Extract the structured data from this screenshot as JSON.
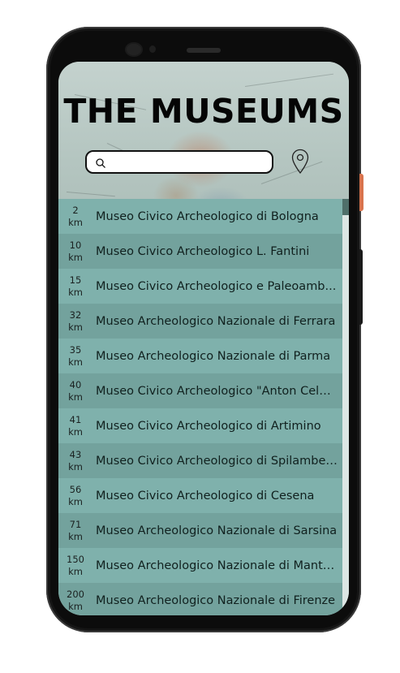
{
  "app": {
    "title": "THE MUSEUMS"
  },
  "search": {
    "value": "",
    "placeholder": ""
  },
  "icons": {
    "search": "search-icon",
    "location": "map-pin-icon"
  },
  "colors": {
    "row_light": "#7fb1ac",
    "row_dark": "#73a29d",
    "title": "#050505"
  },
  "museums": [
    {
      "distance": "2",
      "unit": "km",
      "name": "Museo Civico Archeologico di Bologna"
    },
    {
      "distance": "10",
      "unit": "km",
      "name": "Museo Civico Archeologico L. Fantini"
    },
    {
      "distance": "15",
      "unit": "km",
      "name": "Museo Civico Archeologico e Paleoamb..."
    },
    {
      "distance": "32",
      "unit": "km",
      "name": "Museo Archeologico Nazionale di Ferrara"
    },
    {
      "distance": "35",
      "unit": "km",
      "name": "Museo Archeologico Nazionale di Parma"
    },
    {
      "distance": "40",
      "unit": "km",
      "name": "Museo Civico Archeologico \"Anton Celest..."
    },
    {
      "distance": "41",
      "unit": "km",
      "name": "Museo Civico Archeologico di Artimino"
    },
    {
      "distance": "43",
      "unit": "km",
      "name": "Museo Civico Archeologico di Spilamberto"
    },
    {
      "distance": "56",
      "unit": "km",
      "name": "Museo Civico Archeologico di Cesena"
    },
    {
      "distance": "71",
      "unit": "km",
      "name": "Museo Archeologico Nazionale di Sarsina"
    },
    {
      "distance": "150",
      "unit": "km",
      "name": "Museo Archeologico Nazionale di Mantova"
    },
    {
      "distance": "200",
      "unit": "km",
      "name": "Museo Archeologico Nazionale di Firenze"
    }
  ]
}
